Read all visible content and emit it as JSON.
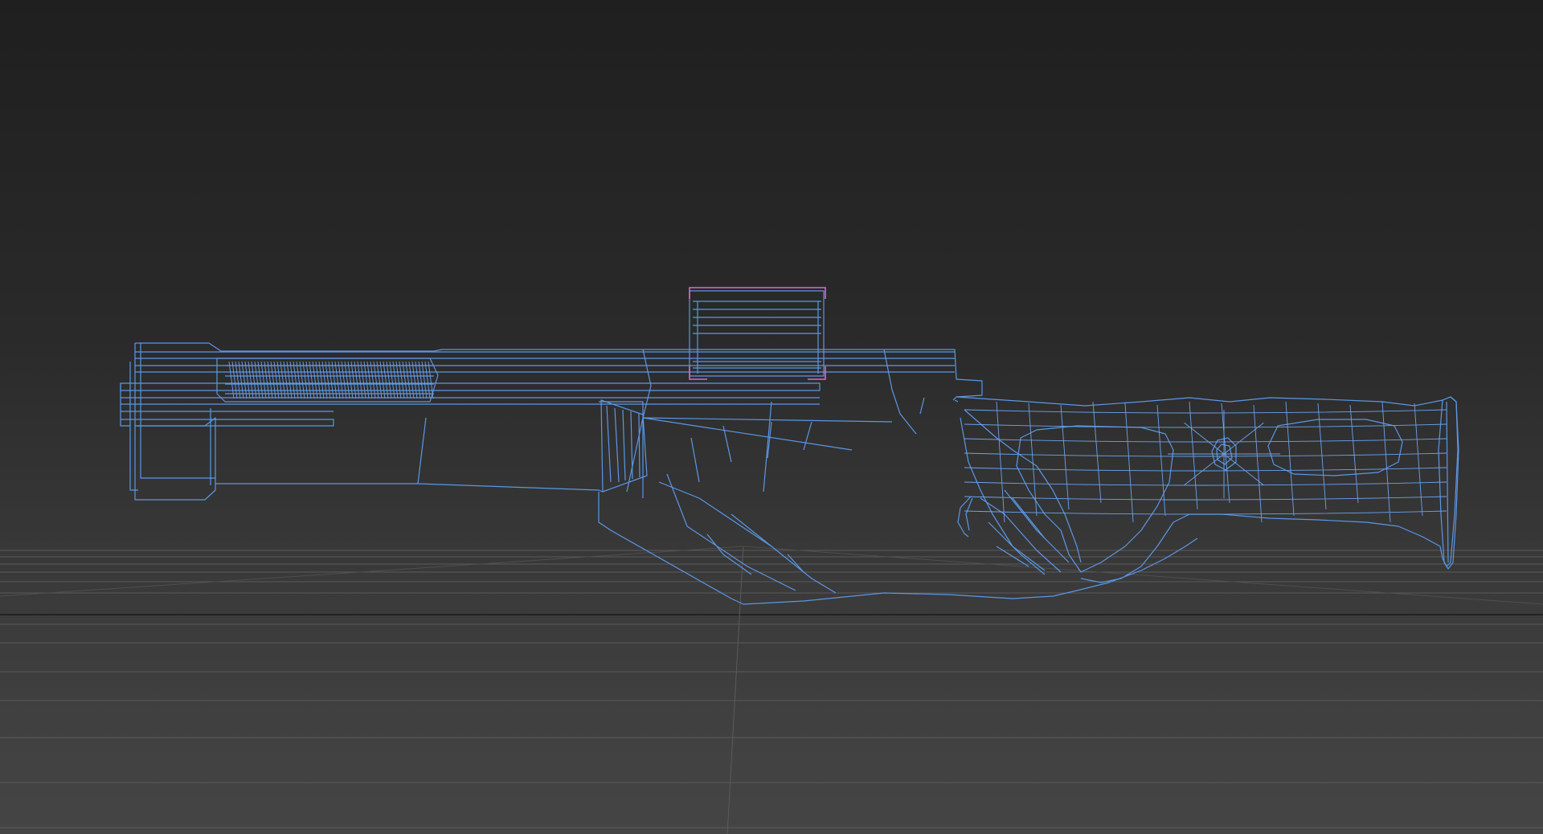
{
  "viewport": {
    "background_top": "#1f1f1f",
    "background_bottom": "#454545",
    "wireframe_color": "#5b97e6",
    "selection_color": "#e067c8",
    "grid_color": "#5a5a5a"
  },
  "scene": {
    "object": "wireframe-rifle-model",
    "selected_part": "top-sight-block"
  }
}
